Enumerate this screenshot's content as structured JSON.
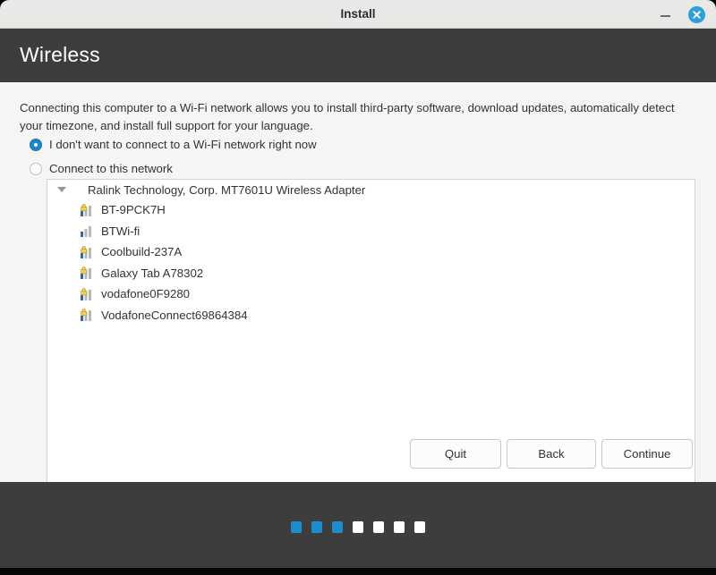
{
  "window": {
    "title": "Install",
    "minimize_icon": "minimize-icon",
    "close_icon": "close-icon"
  },
  "header": {
    "title": "Wireless"
  },
  "content": {
    "intro_text": "Connecting this computer to a Wi-Fi network allows you to install third-party software, download updates, automatically detect your timezone, and install full support for your language.",
    "options": [
      {
        "label": "I don't want to connect to a Wi-Fi network right now",
        "selected": true
      },
      {
        "label": "Connect to this network",
        "selected": false
      }
    ],
    "adapter": {
      "name": "Ralink Technology, Corp. MT7601U Wireless Adapter",
      "expanded": true,
      "expander_icon": "chevron-down-icon"
    },
    "networks": [
      {
        "ssid": "BT-9PCK7H",
        "secured": true,
        "signal": 1
      },
      {
        "ssid": "BTWi-fi",
        "secured": false,
        "signal": 1
      },
      {
        "ssid": "Coolbuild-237A",
        "secured": true,
        "signal": 1
      },
      {
        "ssid": "Galaxy Tab A78302",
        "secured": true,
        "signal": 1
      },
      {
        "ssid": "vodafone0F9280",
        "secured": true,
        "signal": 1
      },
      {
        "ssid": "VodafoneConnect69864384",
        "secured": true,
        "signal": 1
      }
    ]
  },
  "buttons": {
    "quit": "Quit",
    "back": "Back",
    "continue": "Continue"
  },
  "footer": {
    "steps_total": 7,
    "steps_completed": 3
  },
  "colors": {
    "accent_blue": "#1b8ccd",
    "header_dark": "#3d3d3d",
    "content_bg": "#f6f5f4",
    "lock_yellow": "#e8c44a",
    "signal_blue": "#3465a4"
  }
}
